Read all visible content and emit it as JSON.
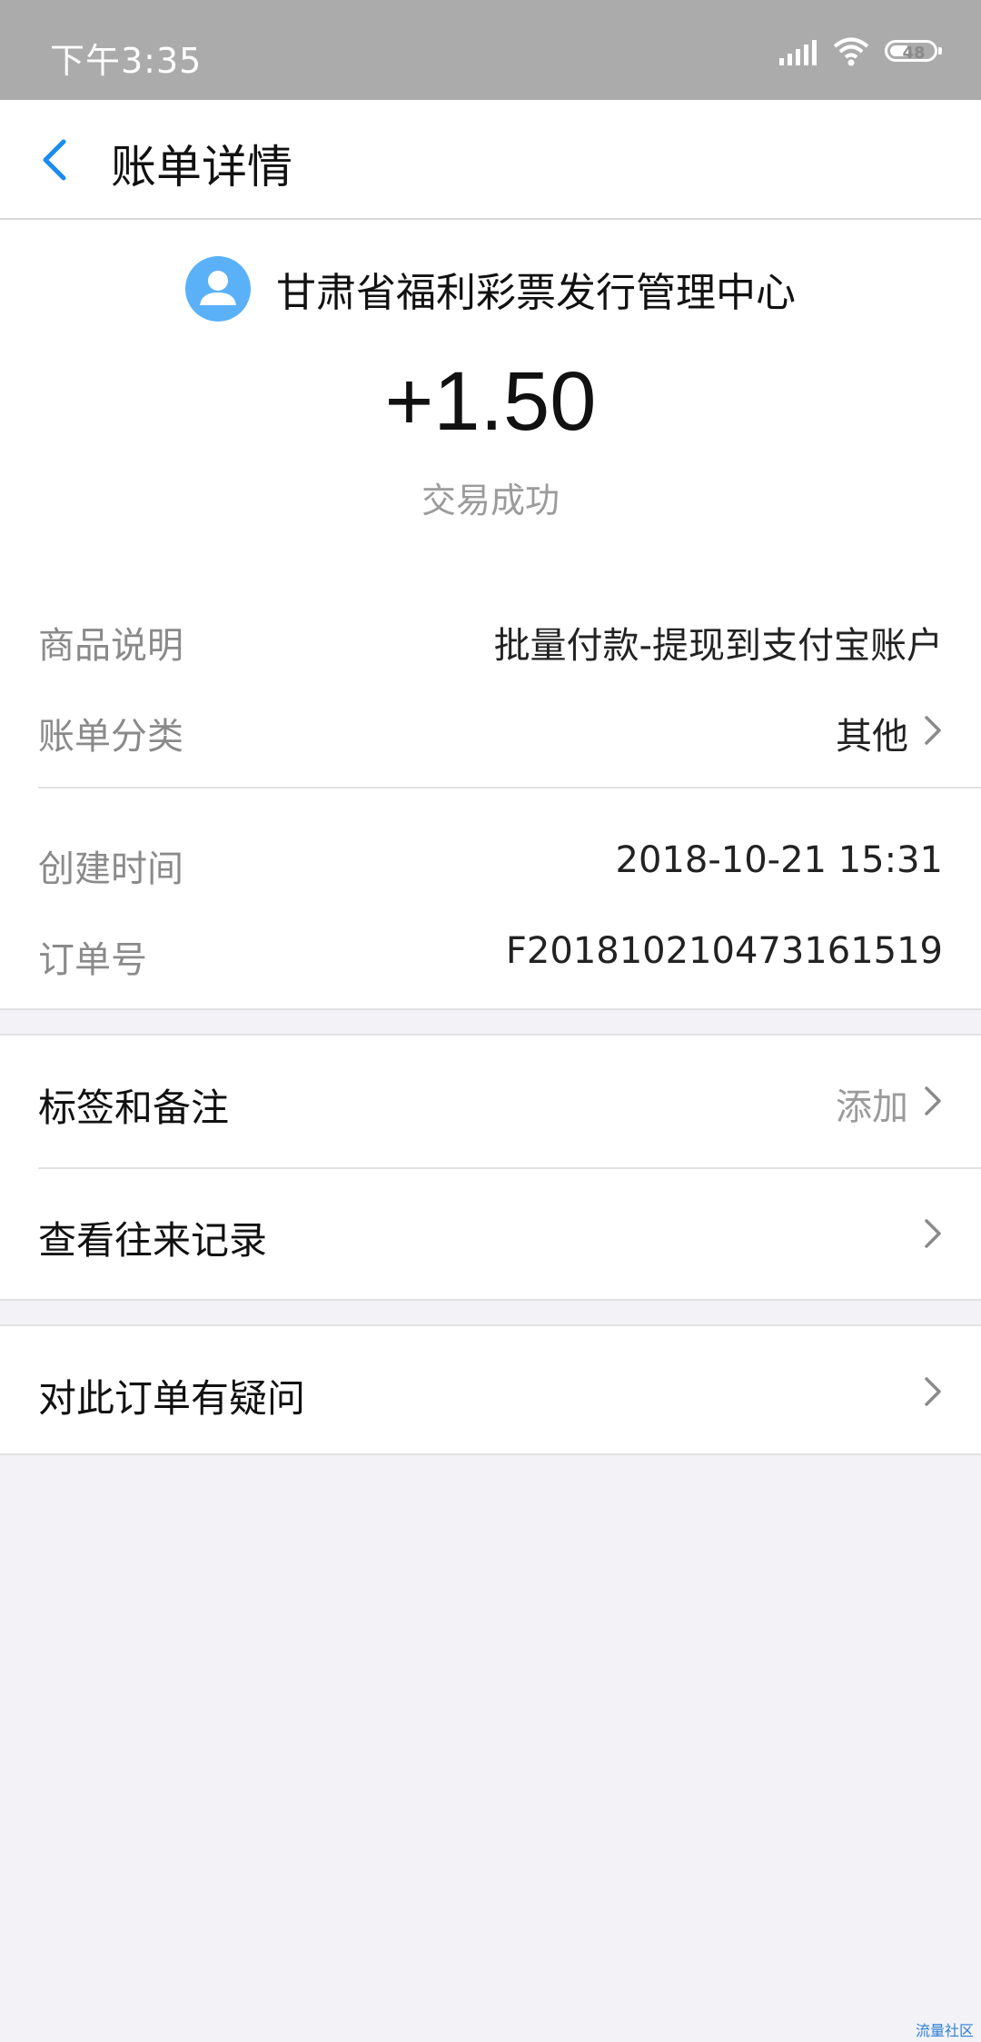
{
  "status_bar": {
    "time": "下午3:35",
    "battery_level": "48",
    "battery_fraction": 0.48,
    "icons": [
      "signal-icon",
      "wifi-icon",
      "battery-icon"
    ]
  },
  "nav": {
    "back_icon": "chevron-left-icon",
    "title": "账单详情"
  },
  "header": {
    "payee_name": "甘肃省福利彩票发行管理中心",
    "avatar_icon": "user-avatar-icon",
    "amount": "+1.50",
    "status": "交易成功"
  },
  "details": [
    {
      "label": "商品说明",
      "value": "批量付款-提现到支付宝账户",
      "has_arrow": false
    },
    {
      "label": "账单分类",
      "value": "其他",
      "has_arrow": true
    }
  ],
  "meta": [
    {
      "label": "创建时间",
      "value": "2018-10-21 15:31"
    },
    {
      "label": "订单号",
      "value": "F20181021047316151​9"
    }
  ],
  "actions": {
    "tags": {
      "label": "标签和备注",
      "value": "添加"
    },
    "history": {
      "label": "查看往来记录"
    },
    "question": {
      "label": "对此订单有疑问"
    }
  },
  "watermark": "流量社区",
  "colors": {
    "accent": "#1a8cf0",
    "status_bar_bg": "#ababab",
    "avatar_bg": "#5bb1f8"
  }
}
